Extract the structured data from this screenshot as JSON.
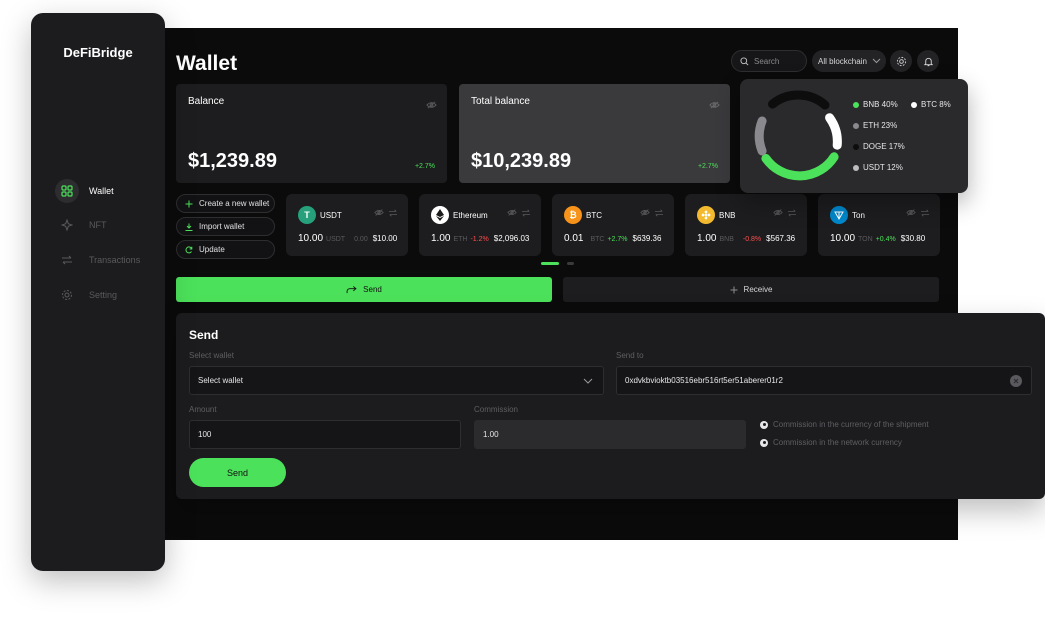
{
  "brand": "DeFiBridge",
  "nav": [
    {
      "label": "Wallet",
      "icon": "grid-icon",
      "active": true
    },
    {
      "label": "NFT",
      "icon": "sparkle-icon",
      "active": false
    },
    {
      "label": "Transactions",
      "icon": "transfer-icon",
      "active": false
    },
    {
      "label": "Setting",
      "icon": "gear-icon",
      "active": false
    }
  ],
  "header": {
    "title": "Wallet",
    "search_placeholder": "Search",
    "chain_filter": "All blockchain"
  },
  "balance": {
    "label": "Balance",
    "amount": "$1,239.89",
    "change": "+2.7%"
  },
  "total_balance": {
    "label": "Total balance",
    "amount": "$10,239.89",
    "change": "+2.7%"
  },
  "allocation": {
    "legend": [
      {
        "label": "BNB 40%",
        "color": "#4ce15a"
      },
      {
        "label": "BTC 8%",
        "color": "#ffffff"
      },
      {
        "label": "ETH 23%",
        "color": "#8a8a8e"
      },
      {
        "label": "DOGE 17%",
        "color": "#0d0d0d"
      },
      {
        "label": "USDT 12%",
        "color": "#bdbdbf"
      }
    ]
  },
  "actions": {
    "create": "Create a new wallet",
    "import": "Import wallet",
    "update": "Update"
  },
  "assets": [
    {
      "name": "USDT",
      "qty": "10.00",
      "sym": "USDT",
      "change": "0.00",
      "usd": "$10.00",
      "color": "#26a17b",
      "dir": "flat"
    },
    {
      "name": "Ethereum",
      "qty": "1.00",
      "sym": "ETH",
      "change": "-1.2%",
      "usd": "$2,096.03",
      "color": "#ffffff",
      "dir": "down"
    },
    {
      "name": "BTC",
      "qty": "0.01",
      "sym": "BTC",
      "change": "+2.7%",
      "usd": "$639.36",
      "color": "#f7931a",
      "dir": "up"
    },
    {
      "name": "BNB",
      "qty": "1.00",
      "sym": "BNB",
      "change": "-0.8%",
      "usd": "$567.36",
      "color": "#f3ba2f",
      "dir": "down"
    },
    {
      "name": "Ton",
      "qty": "10.00",
      "sym": "TON",
      "change": "+0.4%",
      "usd": "$30.80",
      "color": "#0088cc",
      "dir": "up"
    }
  ],
  "tabs": {
    "send": "Send",
    "receive": "Receive"
  },
  "send_form": {
    "title": "Send",
    "select_wallet_label": "Select wallet",
    "select_wallet_value": "Select wallet",
    "send_to_label": "Send to",
    "send_to_value": "0xdvkbvioktb03516ebr516rt5er51aberer01r2",
    "amount_label": "Amount",
    "amount_value": "100",
    "commission_label": "Commission",
    "commission_value": "1.00",
    "commission_option_1": "Commission in the currency of the shipment",
    "commission_option_2": "Commission in the network currency",
    "submit": "Send"
  }
}
